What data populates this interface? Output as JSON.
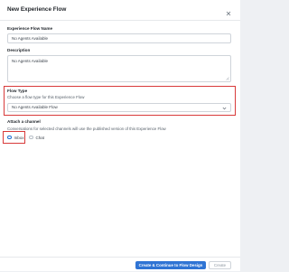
{
  "dialog": {
    "title": "New Experience Flow"
  },
  "name_field": {
    "label": "Experience Flow Name",
    "value": "No Agents Available"
  },
  "description_field": {
    "label": "Description",
    "value": "No Agents Available"
  },
  "flow_type": {
    "label": "Flow Type",
    "help": "Choose a flow type for this Experience Flow",
    "selected": "No Agents Available Flow"
  },
  "channel": {
    "label": "Attach a channel",
    "help": "Conversations for selected channels will use the published version of this Experience Flow",
    "options": [
      {
        "label": "Inbox",
        "selected": true
      },
      {
        "label": "Chat",
        "selected": false
      }
    ]
  },
  "footer": {
    "primary_label": "Create & Continue to Flow Design",
    "secondary_label": "Create"
  },
  "colors": {
    "accent": "#2f74d4",
    "highlight": "#d83a3a"
  }
}
